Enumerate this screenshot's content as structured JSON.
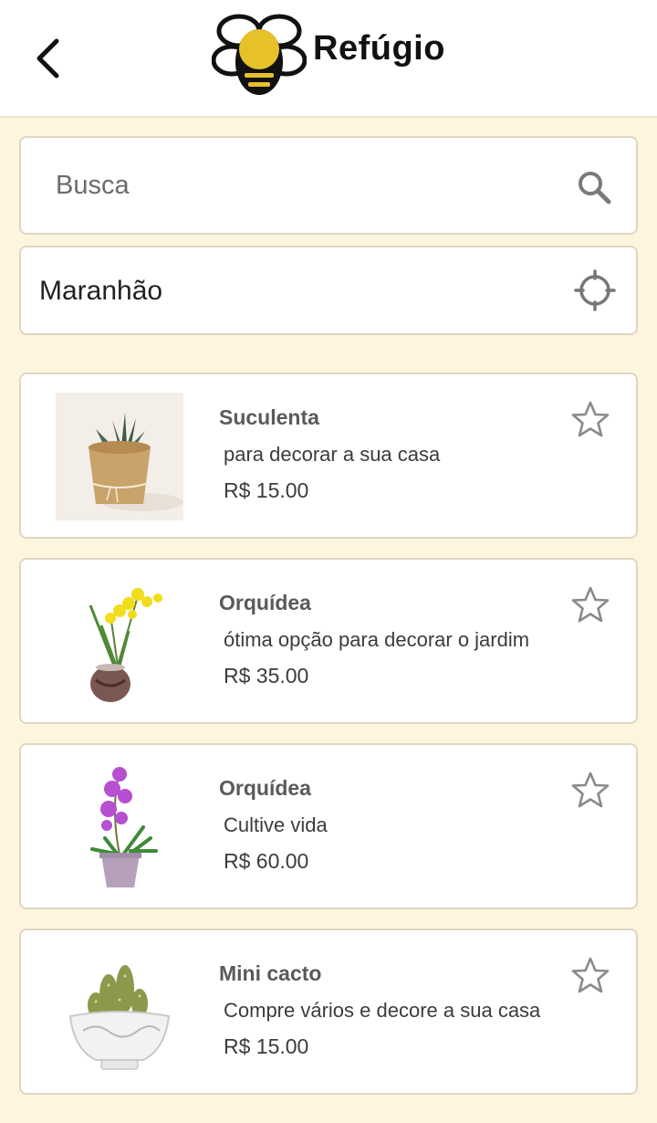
{
  "header": {
    "app_name": "Refúgio",
    "back_icon": "chevron-left-icon",
    "logo_icon": "bee-logo-icon",
    "colors": {
      "background": "#ffffff",
      "brand_yellow": "#e6c12a",
      "brand_black": "#111111"
    }
  },
  "search": {
    "placeholder": "Busca",
    "value": "",
    "icon": "search-icon"
  },
  "location": {
    "value": "Maranhão",
    "icon": "crosshair-icon"
  },
  "products": [
    {
      "title": "Suculenta",
      "description": "para decorar a sua casa",
      "price": "R$ 15.00",
      "image": "succulent-in-kraft-pot",
      "favorite": false
    },
    {
      "title": "Orquídea",
      "description": "ótima opção para decorar o jardim",
      "price": "R$ 35.00",
      "image": "yellow-orchid-in-glass-vase",
      "favorite": false
    },
    {
      "title": "Orquídea",
      "description": "Cultive vida",
      "price": "R$ 60.00",
      "image": "purple-orchid-in-lilac-pot",
      "favorite": false
    },
    {
      "title": "Mini cacto",
      "description": "Compre vários e decore a sua casa",
      "price": "R$ 15.00",
      "image": "mini-cactus-in-white-bowl",
      "favorite": false
    }
  ],
  "colors": {
    "page_background": "#fdf5dd",
    "card_border": "#ddd6c3",
    "title_text": "#5a5a5a",
    "body_text": "#3c3c3c",
    "icon_gray": "#8a8a8a"
  }
}
